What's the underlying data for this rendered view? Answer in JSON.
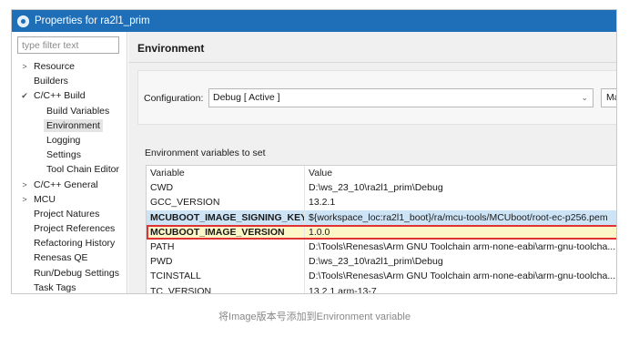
{
  "window": {
    "title": "Properties for ra2l1_prim"
  },
  "sidebar": {
    "filter_placeholder": "type filter text",
    "items": [
      {
        "label": "Resource",
        "arrow": ">"
      },
      {
        "label": "Builders",
        "arrow": ""
      },
      {
        "label": "C/C++ Build",
        "arrow": "v"
      },
      {
        "label": "Build Variables",
        "arrow": ""
      },
      {
        "label": "Environment",
        "arrow": ""
      },
      {
        "label": "Logging",
        "arrow": ""
      },
      {
        "label": "Settings",
        "arrow": ""
      },
      {
        "label": "Tool Chain Editor",
        "arrow": ""
      },
      {
        "label": "C/C++ General",
        "arrow": ">"
      },
      {
        "label": "MCU",
        "arrow": ">"
      },
      {
        "label": "Project Natures",
        "arrow": ""
      },
      {
        "label": "Project References",
        "arrow": ""
      },
      {
        "label": "Refactoring History",
        "arrow": ""
      },
      {
        "label": "Renesas QE",
        "arrow": ""
      },
      {
        "label": "Run/Debug Settings",
        "arrow": ""
      },
      {
        "label": "Task Tags",
        "arrow": ""
      }
    ]
  },
  "main": {
    "title": "Environment",
    "configuration_label": "Configuration:",
    "configuration_value": "Debug  [ Active ]",
    "manage_label": "Manage Configurations...",
    "env_label": "Environment variables to set",
    "columns": [
      "Variable",
      "Value"
    ],
    "rows": [
      {
        "variable": "CWD",
        "value": "D:\\ws_23_10\\ra2l1_prim\\Debug"
      },
      {
        "variable": "GCC_VERSION",
        "value": "13.2.1"
      },
      {
        "variable": "MCUBOOT_IMAGE_SIGNING_KEY",
        "value": "${workspace_loc:ra2l1_boot}/ra/mcu-tools/MCUboot/root-ec-p256.pem"
      },
      {
        "variable": "MCUBOOT_IMAGE_VERSION",
        "value": "1.0.0"
      },
      {
        "variable": "PATH",
        "value": "D:\\Tools\\Renesas\\Arm GNU Toolchain arm-none-eabi\\arm-gnu-toolcha..."
      },
      {
        "variable": "PWD",
        "value": "D:\\ws_23_10\\ra2l1_prim\\Debug"
      },
      {
        "variable": "TCINSTALL",
        "value": "D:\\Tools\\Renesas\\Arm GNU Toolchain arm-none-eabi\\arm-gnu-toolcha..."
      },
      {
        "variable": "TC_VERSION",
        "value": "13.2.1.arm-13-7"
      }
    ]
  },
  "caption": "将Image版本号添加到Environment variable",
  "colors": {
    "titlebar": "#1f6fb8",
    "selected_row": "#cde4f7",
    "highlight_border": "#e03232",
    "highlight_fill": "#fdf6c6"
  }
}
